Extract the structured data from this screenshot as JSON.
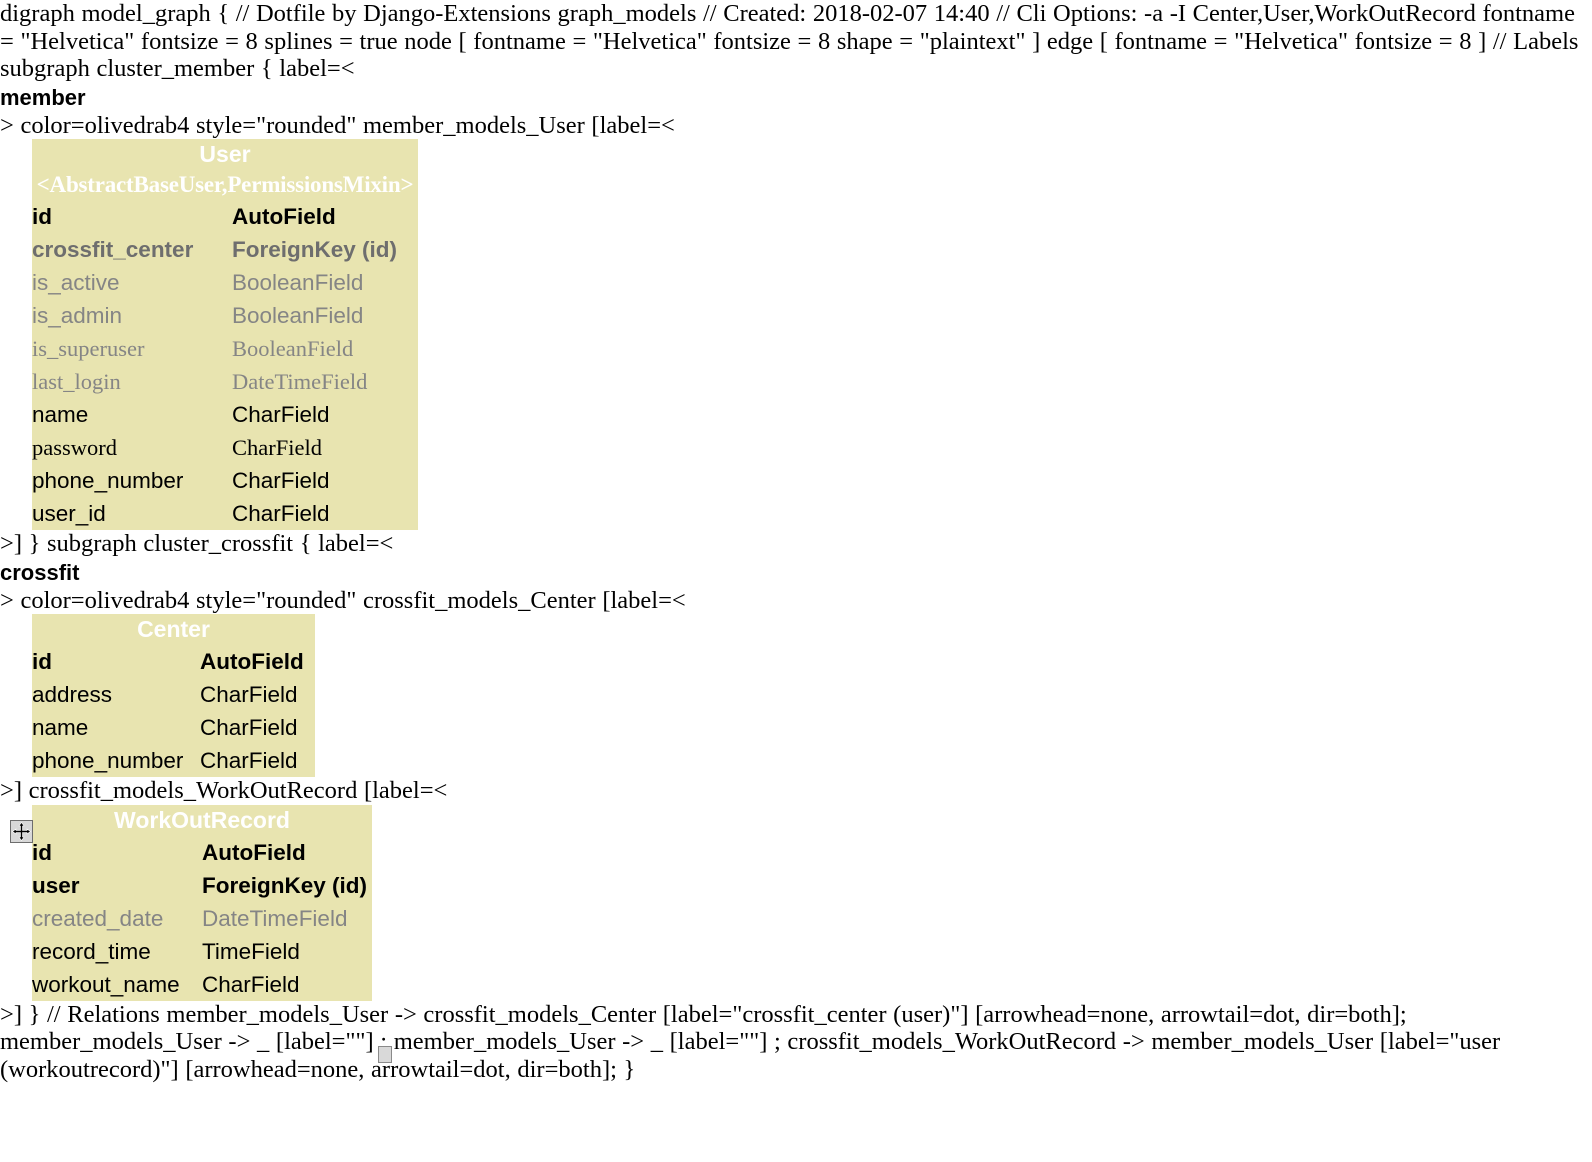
{
  "document": {
    "header_lines": [
      "digraph model_graph { // Dotfile by Django-Extensions graph_models // Created: 2018-02-07 14:40 // Cli Options: -a -I Center,User,WorkOutRecord fontname = \"Helvetica\" fontsize = 8 splines = true node [ fontname = \"Helvetica\" fontsize = 8 shape = \"plaintext\" ] edge [ fontname = \"Helvetica\" fontsize = 8 ] // Labels subgraph cluster_member { label=<"
    ],
    "cluster_member_label": "member",
    "line_after_member": "> color=olivedrab4 style=\"rounded\" member_models_User [label=<",
    "line_after_user_table": ">] } subgraph cluster_crossfit { label=<",
    "cluster_crossfit_label": "crossfit",
    "line_after_crossfit": "> color=olivedrab4 style=\"rounded\" crossfit_models_Center [label=<",
    "line_after_center_table": ">] crossfit_models_WorkOutRecord [label=<",
    "relations_text": ">] } // Relations member_models_User -> crossfit_models_Center [label=\"crossfit_center (user)\"] [arrowhead=none, arrowtail=dot, dir=both]; member_models_User -> _ [label=\"\"] ; member_models_User -> _ [label=\"\"] ; crossfit_models_WorkOutRecord -> member_models_User [label=\"user (workoutrecord)\"] [arrowhead=none, arrowtail=dot, dir=both]; }"
  },
  "colors": {
    "table_background": "#e8e4b0",
    "title_text": "#ffffff",
    "field_black": "#000000",
    "field_grey": "#858585",
    "field_dark_grey": "#6e6e6e",
    "page_background": "#ffffff"
  },
  "tables": [
    {
      "id": "user",
      "title": "User",
      "subtitle": "<AbstractBaseUser,PermissionsMixin>",
      "rows": [
        {
          "name": "id",
          "type": "AutoField",
          "name_style": "f-sans w-bold c-black",
          "type_style": "f-sans w-bold c-black"
        },
        {
          "name": "crossfit_center",
          "type": "ForeignKey (id)",
          "name_style": "f-sans w-bold c-dgrey",
          "type_style": "f-sans w-bold c-dgrey"
        },
        {
          "name": "is_active",
          "type": "BooleanField",
          "name_style": "f-sans w-norm c-grey",
          "type_style": "f-sans w-norm c-grey"
        },
        {
          "name": "is_admin",
          "type": "BooleanField",
          "name_style": "f-sans w-norm c-grey",
          "type_style": "f-sans w-norm c-grey"
        },
        {
          "name": "is_superuser",
          "type": "BooleanField",
          "name_style": "f-serif w-norm c-grey",
          "type_style": "f-serif w-norm c-grey"
        },
        {
          "name": "last_login",
          "type": "DateTimeField",
          "name_style": "f-serif w-norm c-grey",
          "type_style": "f-serif w-norm c-grey"
        },
        {
          "name": "name",
          "type": "CharField",
          "name_style": "f-sans w-norm c-black",
          "type_style": "f-sans w-norm c-black"
        },
        {
          "name": "password",
          "type": "CharField",
          "name_style": "f-serif w-norm c-black",
          "type_style": "f-serif w-norm c-black"
        },
        {
          "name": "phone_number",
          "type": "CharField",
          "name_style": "f-sans w-norm c-black",
          "type_style": "f-sans w-norm c-black"
        },
        {
          "name": "user_id",
          "type": "CharField",
          "name_style": "f-sans w-norm c-black",
          "type_style": "f-sans w-norm c-black"
        }
      ]
    },
    {
      "id": "center",
      "title": "Center",
      "subtitle": "",
      "rows": [
        {
          "name": "id",
          "type": "AutoField",
          "name_style": "f-sans w-bold c-black",
          "type_style": "f-sans w-bold c-black"
        },
        {
          "name": "address",
          "type": "CharField",
          "name_style": "f-sans w-norm c-black",
          "type_style": "f-sans w-norm c-black"
        },
        {
          "name": "name",
          "type": "CharField",
          "name_style": "f-sans w-norm c-black",
          "type_style": "f-sans w-norm c-black"
        },
        {
          "name": "phone_number",
          "type": "CharField",
          "name_style": "f-sans w-norm c-black",
          "type_style": "f-sans w-norm c-black"
        }
      ]
    },
    {
      "id": "workoutrecord",
      "title": "WorkOutRecord",
      "subtitle": "",
      "rows": [
        {
          "name": "id",
          "type": "AutoField",
          "name_style": "f-sans w-bold c-black",
          "type_style": "f-sans w-bold c-black"
        },
        {
          "name": "user",
          "type": "ForeignKey (id)",
          "name_style": "f-sans w-bold c-black",
          "type_style": "f-sans w-bold c-black"
        },
        {
          "name": "created_date",
          "type": "DateTimeField",
          "name_style": "f-sans w-norm c-grey",
          "type_style": "f-sans w-norm c-grey"
        },
        {
          "name": "record_time",
          "type": "TimeField",
          "name_style": "f-sans w-norm c-black",
          "type_style": "f-sans w-norm c-black"
        },
        {
          "name": "workout_name",
          "type": "CharField",
          "name_style": "f-sans w-norm c-black",
          "type_style": "f-sans w-norm c-black"
        }
      ]
    }
  ],
  "cursors": {
    "move_cursor_icon": "move-cursor-icon",
    "text_cursor_icon": "text-cursor-icon"
  }
}
